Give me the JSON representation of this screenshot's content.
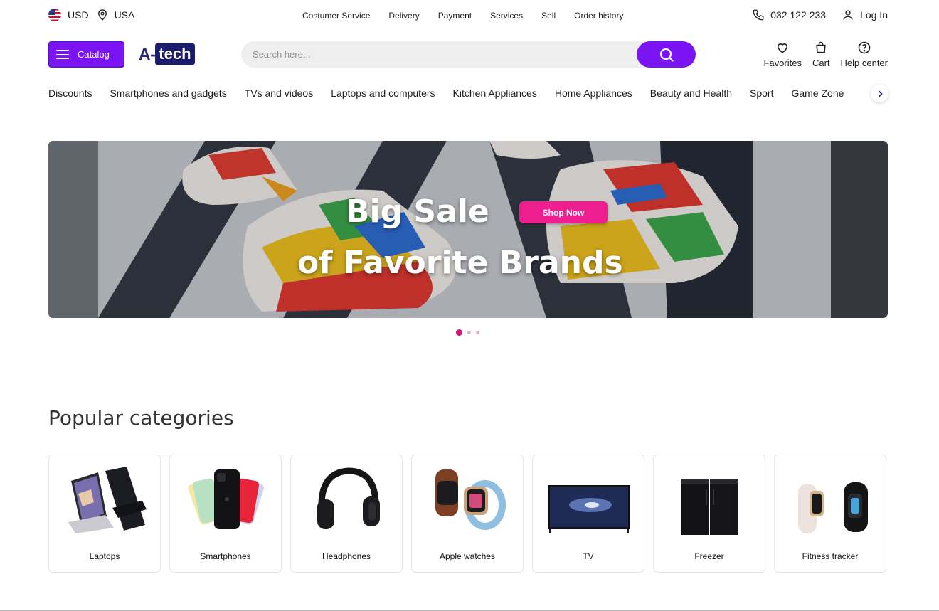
{
  "topbar": {
    "currency": "USD",
    "country": "USA",
    "links": [
      "Costumer Service",
      "Delivery",
      "Payment",
      "Services",
      "Sell",
      "Order history"
    ],
    "phone": "032 122 233",
    "login": "Log In"
  },
  "header": {
    "catalog_label": "Catalog",
    "logo_a": "A-",
    "logo_tech": "tech",
    "search_placeholder": "Search here...",
    "favorites": "Favorites",
    "cart": "Cart",
    "help": "Help center"
  },
  "catnav": [
    "Discounts",
    "Smartphones and gadgets",
    "TVs and videos",
    "Laptops and computers",
    "Kitchen Appliances",
    "Home Appliances",
    "Beauty and Health",
    "Sport",
    "Game Zone"
  ],
  "banner": {
    "line1": "Big Sale",
    "line2": "of Favorite Brands",
    "cta": "Shop Now",
    "slides_total": 3,
    "active_slide": 1
  },
  "popular": {
    "title": "Popular categories",
    "items": [
      {
        "label": "Laptops",
        "icon": "laptop-icon"
      },
      {
        "label": "Smartphones",
        "icon": "smartphone-icon"
      },
      {
        "label": "Headphones",
        "icon": "headphones-icon"
      },
      {
        "label": "Apple watches",
        "icon": "watch-icon"
      },
      {
        "label": "TV",
        "icon": "tv-icon"
      },
      {
        "label": "Freezer",
        "icon": "freezer-icon"
      },
      {
        "label": "Fitness tracker",
        "icon": "fitness-tracker-icon"
      }
    ]
  },
  "colors": {
    "accent": "#7a14f2",
    "cta_pink": "#ee1e8e",
    "logo_navy": "#1c1c6e"
  }
}
